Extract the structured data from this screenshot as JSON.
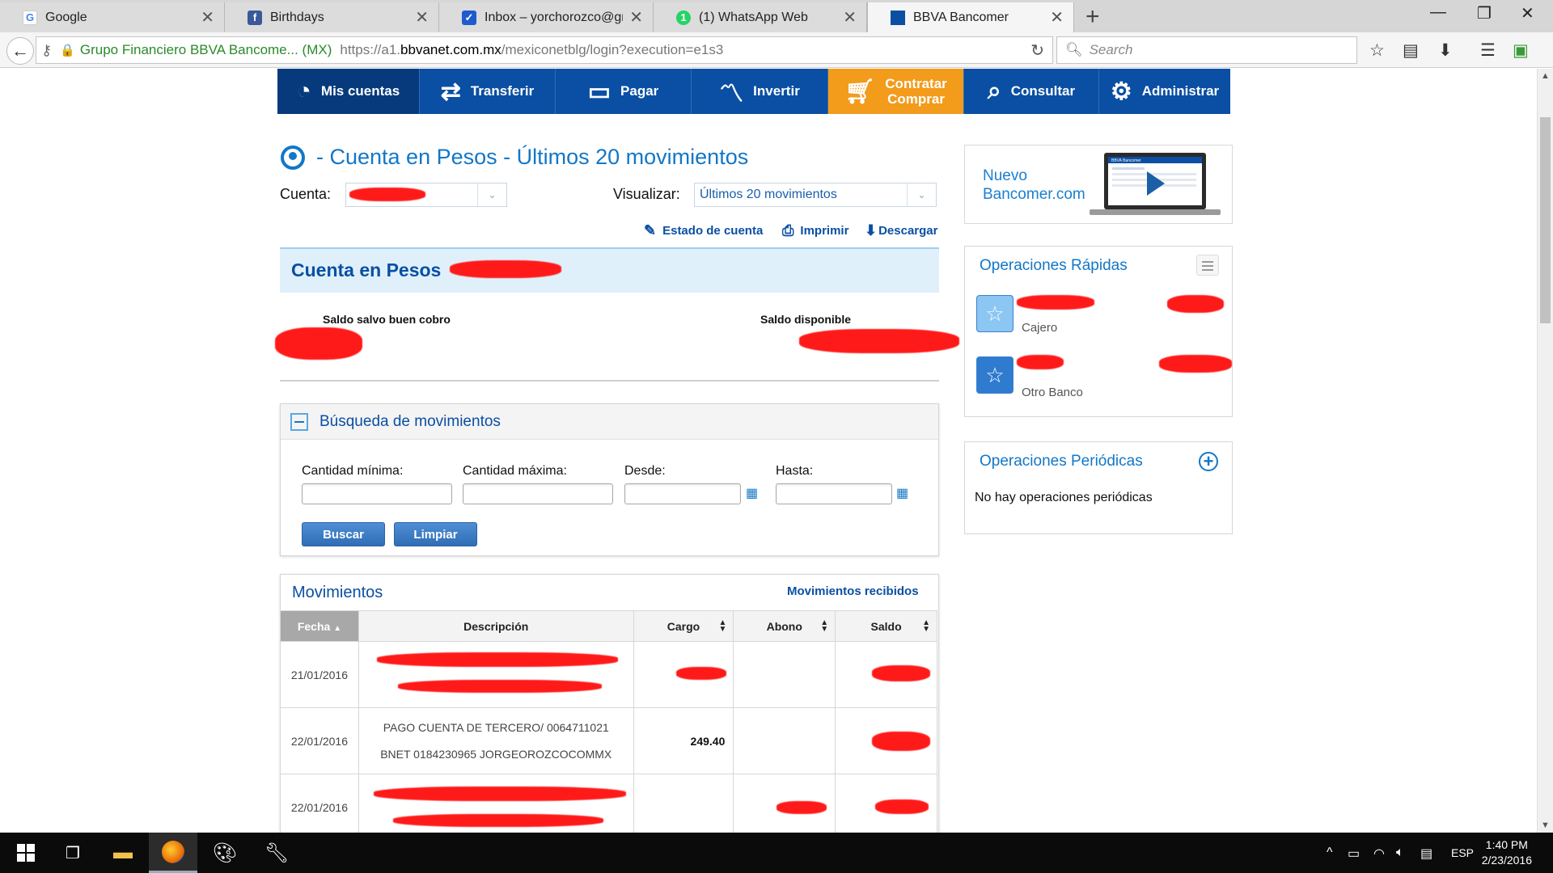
{
  "browser": {
    "tabs": [
      {
        "title": "Google",
        "icon": "google-favicon",
        "color": "#4285f4"
      },
      {
        "title": "Birthdays",
        "icon": "facebook-favicon",
        "color": "#3b5998"
      },
      {
        "title": "Inbox – yorchorozco@gm…",
        "icon": "inbox-favicon",
        "color": "#1e5bcf"
      },
      {
        "title": "(1) WhatsApp Web",
        "icon": "whatsapp-favicon",
        "color": "#25d366"
      },
      {
        "title": "BBVA Bancomer",
        "icon": "bbva-favicon",
        "color": "#0a4fa3"
      }
    ],
    "identity": "Grupo Financiero BBVA Bancome... (MX)",
    "url_prefix": "https://a1.",
    "url_domain": "bbvanet.com.mx",
    "url_path": "/mexiconetblg/login?execution=e1s3",
    "search_placeholder": "Search"
  },
  "nav": {
    "items": [
      {
        "label": "Mis cuentas",
        "icon": "pie-chart-icon"
      },
      {
        "label": "Transferir",
        "icon": "transfer-arrows-icon"
      },
      {
        "label": "Pagar",
        "icon": "card-icon"
      },
      {
        "label": "Invertir",
        "icon": "trend-line-icon"
      },
      {
        "label": "Contratar",
        "label2": "Comprar",
        "icon": "cart-icon"
      },
      {
        "label": "Consultar",
        "icon": "magnifier-doc-icon"
      },
      {
        "label": "Administrar",
        "icon": "gears-icon"
      }
    ],
    "accent_blue": "#0a4fa3",
    "accent_orange": "#f39b1b"
  },
  "main": {
    "title": "- Cuenta en Pesos - Últimos 20 movimientos",
    "cuenta_label": "Cuenta:",
    "visualizar_label": "Visualizar:",
    "visualizar_value": "Últimos 20 movimientos",
    "tools": {
      "estado": "Estado de cuenta",
      "imprimir": "Imprimir",
      "descargar": "Descargar"
    },
    "account_header": "Cuenta en Pesos",
    "saldo_salvo": "Saldo salvo buen cobro",
    "saldo_disponible": "Saldo disponible"
  },
  "search": {
    "title": "Búsqueda de movimientos",
    "cantidad_min": "Cantidad mínima:",
    "cantidad_max": "Cantidad máxima:",
    "desde": "Desde:",
    "hasta": "Hasta:",
    "buscar": "Buscar",
    "limpiar": "Limpiar"
  },
  "movimientos": {
    "title": "Movimientos",
    "recibidos_link": "Movimientos recibidos",
    "columns": [
      "Fecha",
      "Descripción",
      "Cargo",
      "Abono",
      "Saldo"
    ],
    "rows": [
      {
        "fecha": "21/01/2016",
        "desc1": "",
        "desc2": "",
        "cargo": "",
        "abono": "",
        "saldo": ""
      },
      {
        "fecha": "22/01/2016",
        "desc1": "PAGO CUENTA DE TERCERO/ 0064711021",
        "desc2": "BNET 0184230965 JORGEOROZCOCOMMX",
        "cargo": "249.40",
        "abono": "",
        "saldo": ""
      },
      {
        "fecha": "22/01/2016",
        "desc1": "",
        "desc2": "",
        "cargo": "",
        "abono": "",
        "saldo": ""
      }
    ]
  },
  "sidebar": {
    "promo_line1": "Nuevo",
    "promo_line2": "Bancomer.com",
    "promo_screen_caption": "BBVA Bancomer",
    "rapidas_title": "Operaciones Rápidas",
    "rapidas": [
      {
        "label": "Cajero"
      },
      {
        "label": "Otro Banco"
      }
    ],
    "periodicas_title": "Operaciones Periódicas",
    "periodicas_empty": "No hay operaciones periódicas"
  },
  "taskbar": {
    "lang": "ESP",
    "time": "1:40 PM",
    "date": "2/23/2016"
  }
}
